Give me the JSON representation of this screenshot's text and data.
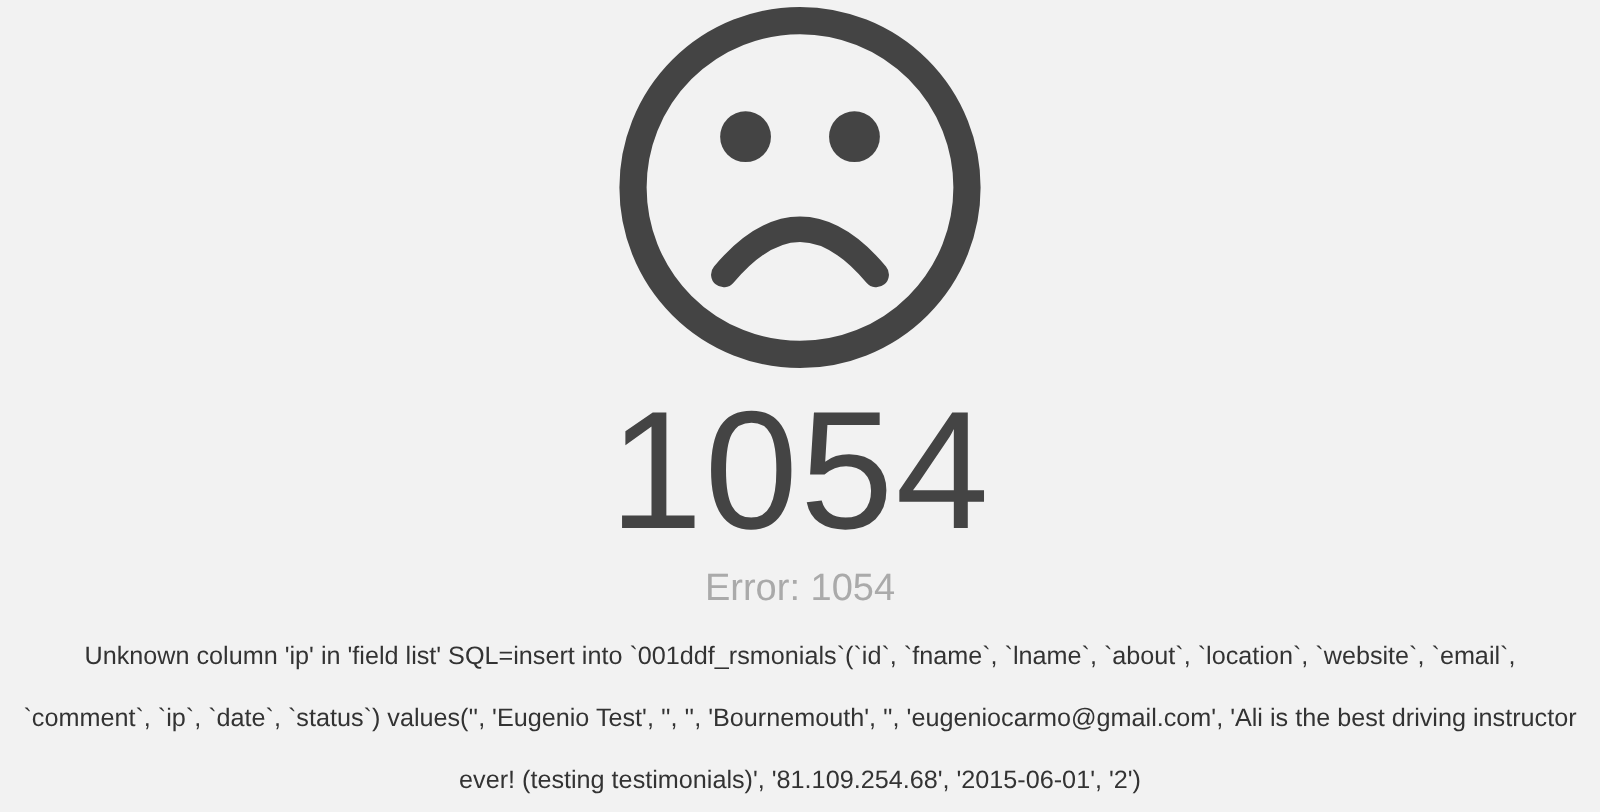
{
  "error": {
    "code": "1054",
    "title": "Error: 1054",
    "message": "Unknown column 'ip' in 'field list' SQL=insert into `001ddf_rsmonials`(`id`, `fname`, `lname`, `about`, `location`, `website`, `email`, `comment`, `ip`, `date`, `status`) values('', 'Eugenio Test', '', '', 'Bournemouth', '', 'eugeniocarmo@gmail.com', 'Ali is the best driving instructor ever! (testing testimonials)', '81.109.254.68', '2015-06-01', '2')"
  }
}
